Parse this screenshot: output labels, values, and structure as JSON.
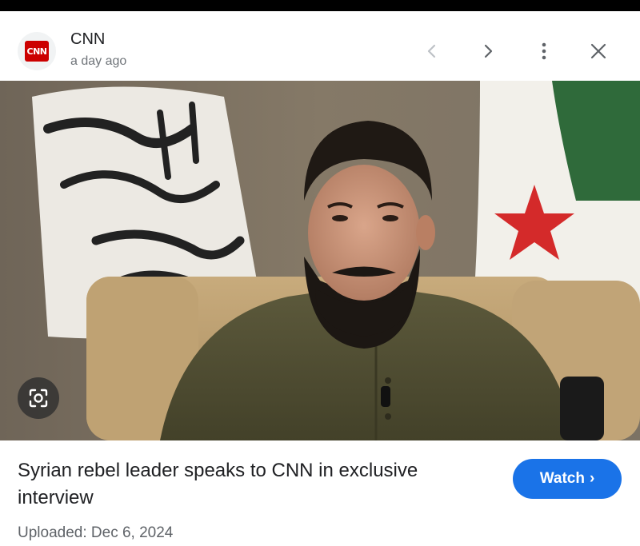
{
  "header": {
    "source_name": "CNN",
    "timestamp": "a day ago",
    "logo_text": "CNN"
  },
  "actions": {
    "prev_icon": "chevron-left-icon",
    "next_icon": "chevron-right-icon",
    "more_icon": "more-vertical-icon",
    "close_icon": "close-icon"
  },
  "media": {
    "lens_icon": "image-search-icon"
  },
  "article": {
    "title": "Syrian rebel leader speaks to CNN in exclusive interview",
    "watch_label": "Watch",
    "watch_chevron": "›",
    "upload_label": "Uploaded:",
    "upload_date": "Dec 6, 2024"
  },
  "colors": {
    "accent": "#1a73e8",
    "brand": "#cc0000"
  }
}
